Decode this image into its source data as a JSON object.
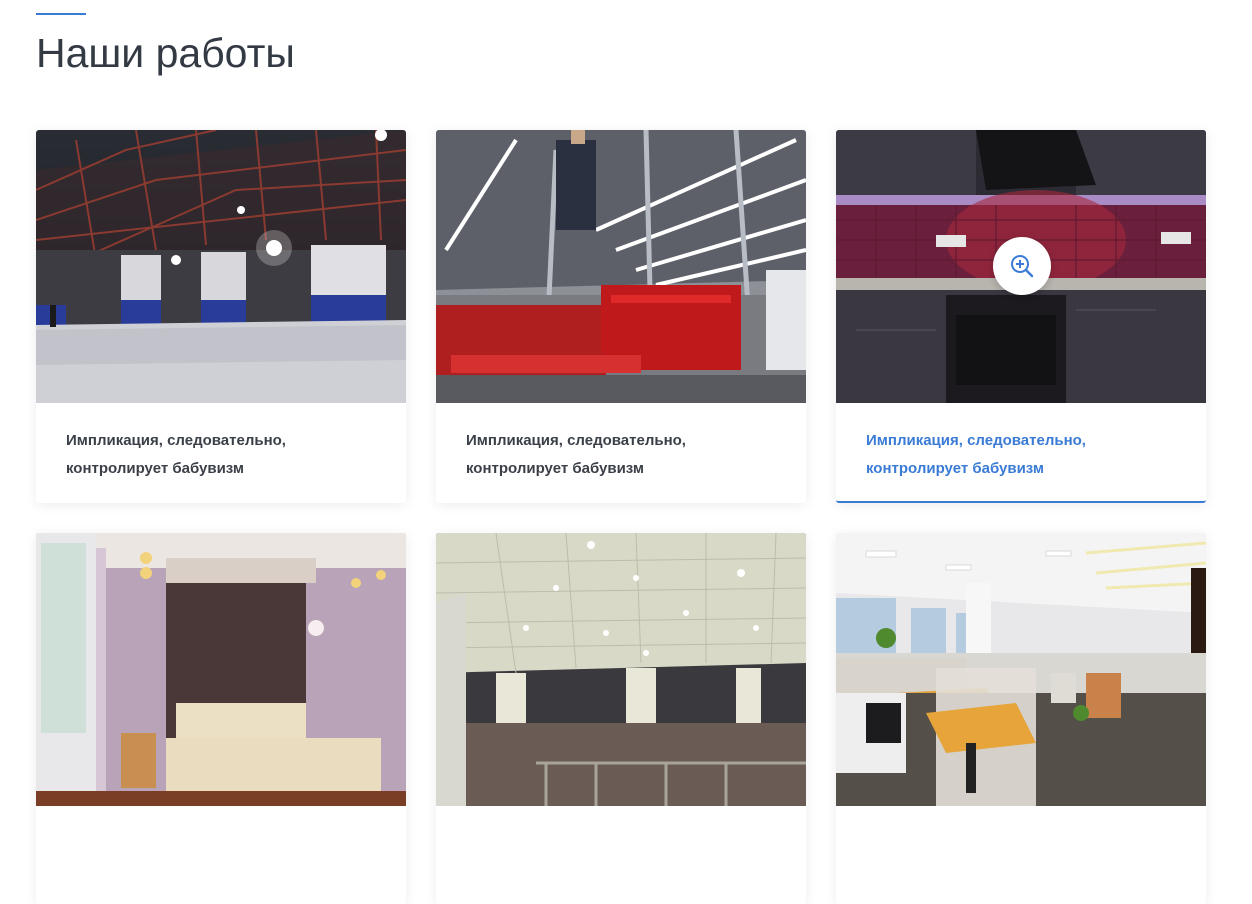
{
  "section": {
    "title": "Наши работы",
    "accent_color": "#3a7bd5"
  },
  "gallery": {
    "items": [
      {
        "caption": "Импликация, следовательно, контролирует бабувизм",
        "image": "warehouse-hangar-photo",
        "active": false
      },
      {
        "caption": "Импликация, следовательно, контролирует бабувизм",
        "image": "industrial-ceiling-installation-photo",
        "active": false
      },
      {
        "caption": "Импликация, следовательно, контролирует бабувизм",
        "image": "kitchen-led-backsplash-photo",
        "active": true,
        "overlay_icon": "zoom-in-icon"
      },
      {
        "caption": "",
        "image": "bedroom-interior-photo",
        "active": false
      },
      {
        "caption": "",
        "image": "hall-ceiling-lights-photo",
        "active": false
      },
      {
        "caption": "",
        "image": "open-office-photo",
        "active": false
      }
    ]
  }
}
